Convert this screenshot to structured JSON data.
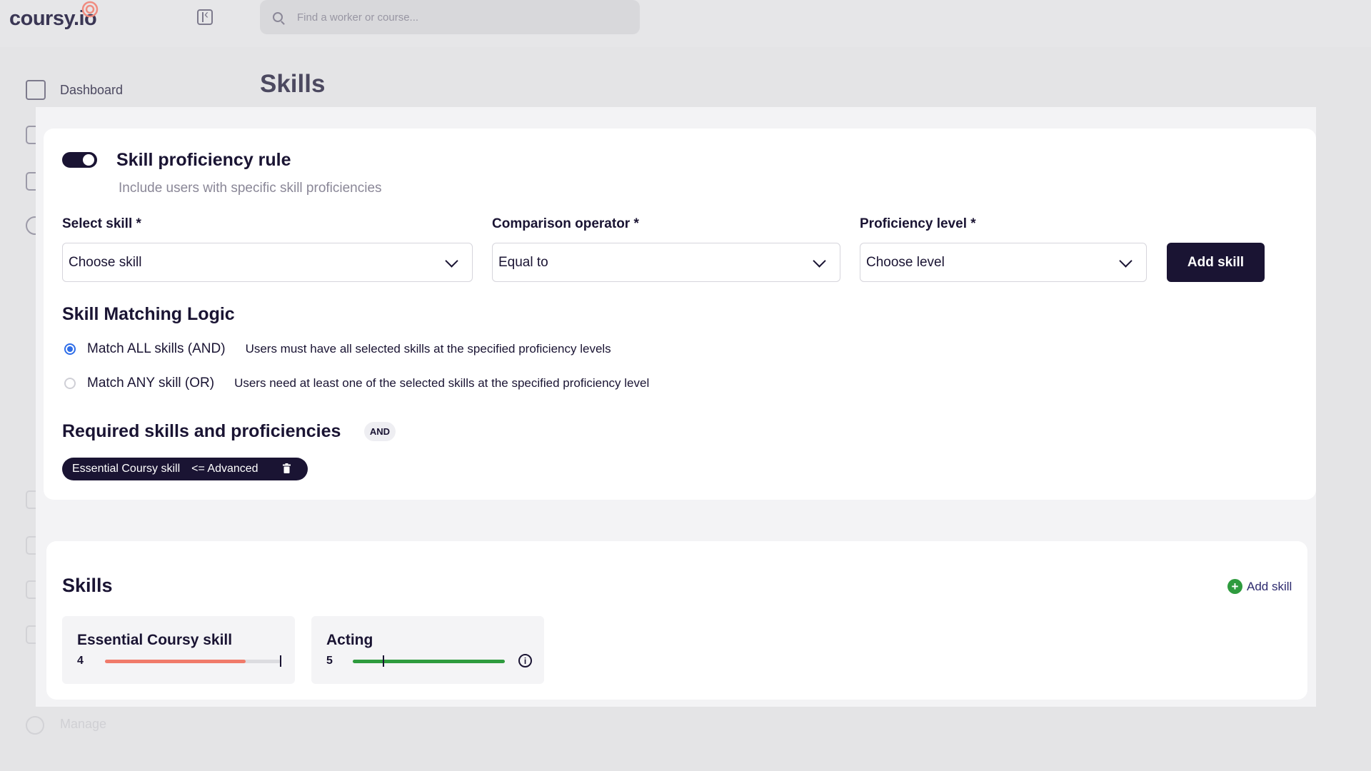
{
  "app": {
    "logo_text": "coursy.io"
  },
  "search": {
    "placeholder": "Find a worker or course..."
  },
  "sidebar": {
    "items": [
      {
        "label": "Dashboard",
        "icon": "dashboard-icon"
      }
    ],
    "footer_item": {
      "label": "Manage",
      "icon": "gear-icon"
    }
  },
  "page": {
    "title": "Skills"
  },
  "rule": {
    "enabled": true,
    "title": "Skill proficiency rule",
    "subtitle": "Include users with specific skill proficiencies",
    "fields": {
      "skill_label": "Select skill *",
      "skill_value": "Choose skill",
      "operator_label": "Comparison operator *",
      "operator_value": "Equal to",
      "level_label": "Proficiency level *",
      "level_value": "Choose level"
    },
    "add_button": "Add skill",
    "matching": {
      "title": "Skill Matching Logic",
      "options": [
        {
          "label": "Match ALL skills (AND)",
          "description": "Users must have all selected skills at the specified proficiency levels",
          "selected": true
        },
        {
          "label": "Match ANY skill (OR)",
          "description": "Users need at least one of the selected skills at the specified proficiency level",
          "selected": false
        }
      ]
    },
    "required": {
      "title": "Required skills and proficiencies",
      "badge": "AND",
      "chips": [
        {
          "skill": "Essential Coursy skill",
          "operator": "<= Advanced"
        }
      ]
    }
  },
  "skills_panel": {
    "title": "Skills",
    "add_link": "Add skill",
    "skills": [
      {
        "name": "Essential Coursy skill",
        "level": "4",
        "progress": 0.8,
        "bar_color": "#f07a6a",
        "marker": 1.0,
        "info": false
      },
      {
        "name": "Acting",
        "level": "5",
        "progress": 1.0,
        "bar_color": "#2e9b3e",
        "marker": 0.2,
        "info": true
      }
    ]
  },
  "colors": {
    "primary": "#1a1433",
    "radio_selected": "#2f6ee8",
    "success": "#2e9b3e",
    "accent_coral": "#f07a6a"
  }
}
